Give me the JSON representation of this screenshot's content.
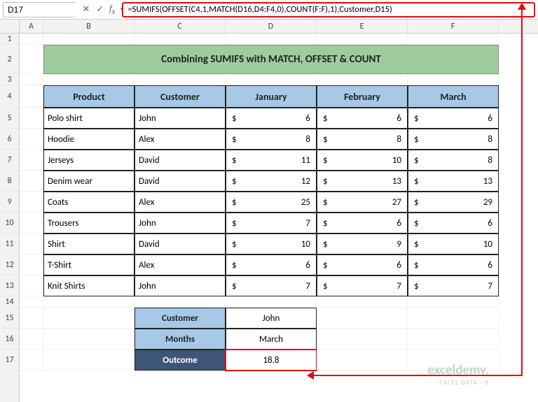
{
  "topbar": {
    "name_box": "D17",
    "formula": "=SUMIFS(OFFSET(C4,1,MATCH(D16,D4:F4,0),COUNT(F:F),1),Customer,D15)"
  },
  "columns": [
    "A",
    "B",
    "C",
    "D",
    "E",
    "F"
  ],
  "row_heights": {
    "r1": 16,
    "r2": 42,
    "r3": 16,
    "r4": 32,
    "r5": 30,
    "r6": 30,
    "r7": 30,
    "r8": 30,
    "r9": 30,
    "r10": 30,
    "r11": 30,
    "r12": 30,
    "r13": 30,
    "r14": 16,
    "r15": 30,
    "r16": 30,
    "r17": 30
  },
  "title": "Combining SUMIFS with MATCH, OFFSET & COUNT",
  "headers": [
    "Product",
    "Customer",
    "January",
    "February",
    "March"
  ],
  "rows": [
    {
      "product": "Polo shirt",
      "customer": "John",
      "jan": 6,
      "feb": 6,
      "mar": 6
    },
    {
      "product": "Hoodie",
      "customer": "Alex",
      "jan": 8,
      "feb": 8,
      "mar": 8
    },
    {
      "product": "Jerseys",
      "customer": "David",
      "jan": 11,
      "feb": 10,
      "mar": 8
    },
    {
      "product": "Denim wear",
      "customer": "David",
      "jan": 12,
      "feb": 13,
      "mar": 13
    },
    {
      "product": "Coats",
      "customer": "Alex",
      "jan": 25,
      "feb": 27,
      "mar": 29
    },
    {
      "product": "Trousers",
      "customer": "John",
      "jan": 7,
      "feb": 6,
      "mar": 6
    },
    {
      "product": "Shirt",
      "customer": "David",
      "jan": 10,
      "feb": 9,
      "mar": 10
    },
    {
      "product": "T-Shirt",
      "customer": "Alex",
      "jan": 6,
      "feb": 6,
      "mar": 6
    },
    {
      "product": "Knit Shirts",
      "customer": "John",
      "jan": 7,
      "feb": 7,
      "mar": 7
    }
  ],
  "lookup": {
    "labels": {
      "customer": "Customer",
      "months": "Months",
      "outcome": "Outcome"
    },
    "values": {
      "customer": "John",
      "months": "March",
      "outcome": "18.8"
    }
  },
  "currency_symbol": "$",
  "watermark": {
    "brand": "exceldemy",
    "tag": "EXCEL DATA · B"
  }
}
